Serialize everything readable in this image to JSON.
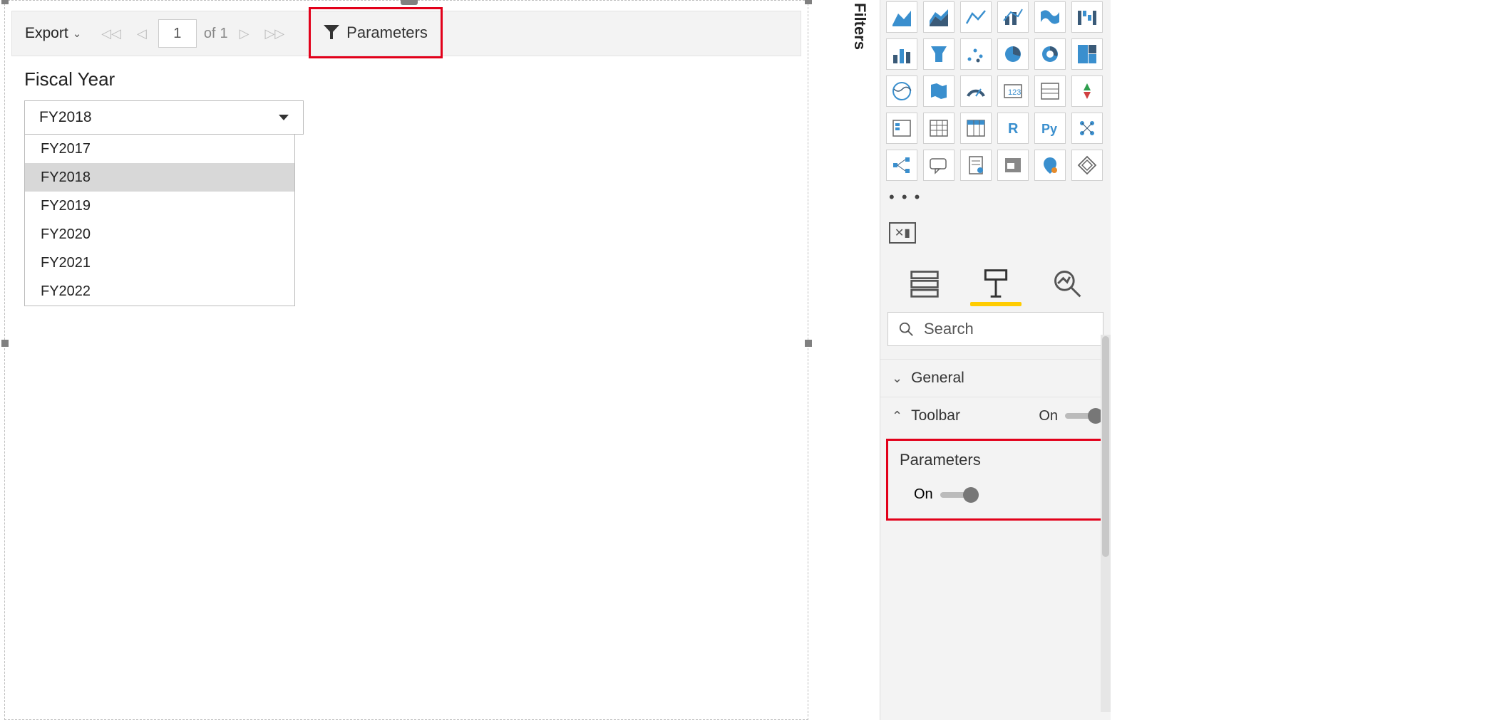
{
  "toolbar": {
    "export_label": "Export",
    "page_input": "1",
    "of_label": "of",
    "total_pages": "1",
    "parameters_label": "Parameters"
  },
  "parameter": {
    "label": "Fiscal Year",
    "selected": "FY2018",
    "options": [
      "FY2017",
      "FY2018",
      "FY2019",
      "FY2020",
      "FY2021",
      "FY2022"
    ]
  },
  "filters_tab": "Filters",
  "search_placeholder": "Search",
  "format": {
    "general_label": "General",
    "toolbar_label": "Toolbar",
    "toolbar_state": "On",
    "parameters_label": "Parameters",
    "parameters_state": "On"
  },
  "viz_icons": [
    "area-chart",
    "stacked-area",
    "line",
    "combo",
    "ribbon",
    "waterfall",
    "bar",
    "funnel",
    "scatter",
    "pie",
    "donut",
    "treemap",
    "map",
    "filled-map",
    "gauge",
    "card",
    "multirow",
    "kpi",
    "slicer",
    "table",
    "matrix",
    "r",
    "python",
    "keyinfluencers",
    "decomposition",
    "qna",
    "paginated",
    "narrative",
    "arcgis",
    "powerapps"
  ]
}
